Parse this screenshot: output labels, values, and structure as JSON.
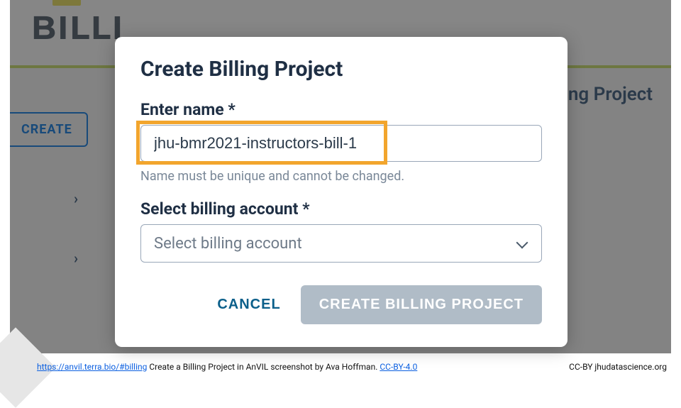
{
  "background": {
    "page_title_fragment": "BILLI",
    "right_text_fragment": "ng Project",
    "create_button": "CREATE"
  },
  "modal": {
    "title": "Create Billing Project",
    "name_label": "Enter name *",
    "name_value": "jhu-bmr2021-instructors-bill-1",
    "name_hint": "Name must be unique and cannot be changed.",
    "account_label": "Select billing account *",
    "account_placeholder": "Select billing account",
    "cancel": "CANCEL",
    "submit": "CREATE BILLING PROJECT"
  },
  "footer": {
    "url": "https://anvil.terra.bio/#billing",
    "caption": " Create a Billing Project in AnVIL screenshot by Ava Hoffman. ",
    "license": "CC-BY-4.0",
    "right": "CC-BY  jhudatascience.org"
  }
}
